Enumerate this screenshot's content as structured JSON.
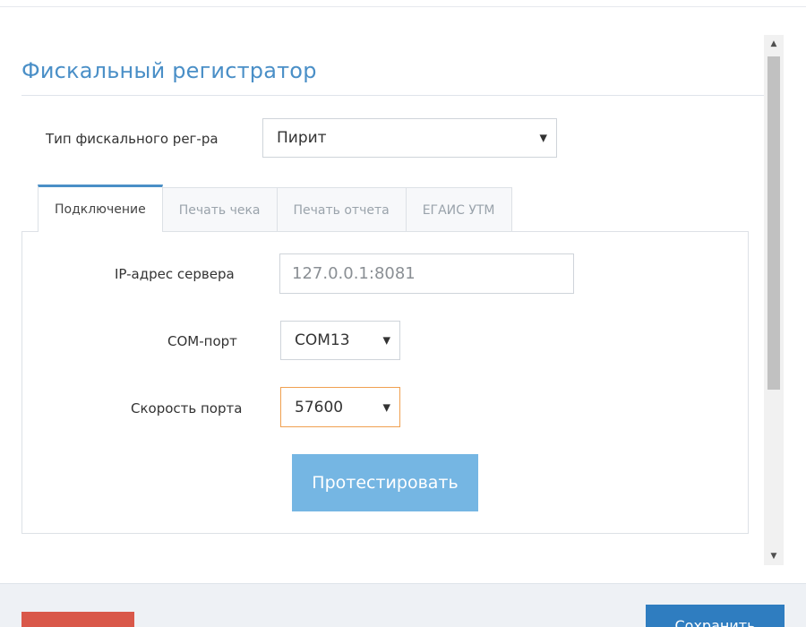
{
  "colors": {
    "accent": "#4a8fc7",
    "title": "#4a8fc7",
    "test_button": "#75b6e3",
    "danger_button": "#d9584a",
    "primary_button": "#2f7dc0",
    "focus_border": "#f0a050"
  },
  "section": {
    "title": "Фискальный регистратор"
  },
  "fiscal_type": {
    "label": "Тип фискального рег-ра",
    "value": "Пирит",
    "arrow": "▼"
  },
  "tabs": [
    {
      "label": "Подключение",
      "active": true
    },
    {
      "label": "Печать чека",
      "active": false
    },
    {
      "label": "Печать отчета",
      "active": false
    },
    {
      "label": "ЕГАИС УТМ",
      "active": false
    }
  ],
  "connection": {
    "ip_label": "IP-адрес сервера",
    "ip_placeholder": "127.0.0.1:8081",
    "com_label": "COM-порт",
    "com_value": "COM13",
    "speed_label": "Скорость порта",
    "speed_value": "57600",
    "arrow": "▼",
    "test_button": "Протестировать"
  },
  "scrollbar": {
    "up_icon": "▲",
    "down_icon": "▼"
  },
  "footer": {
    "right_button_label": "Сохранить"
  }
}
